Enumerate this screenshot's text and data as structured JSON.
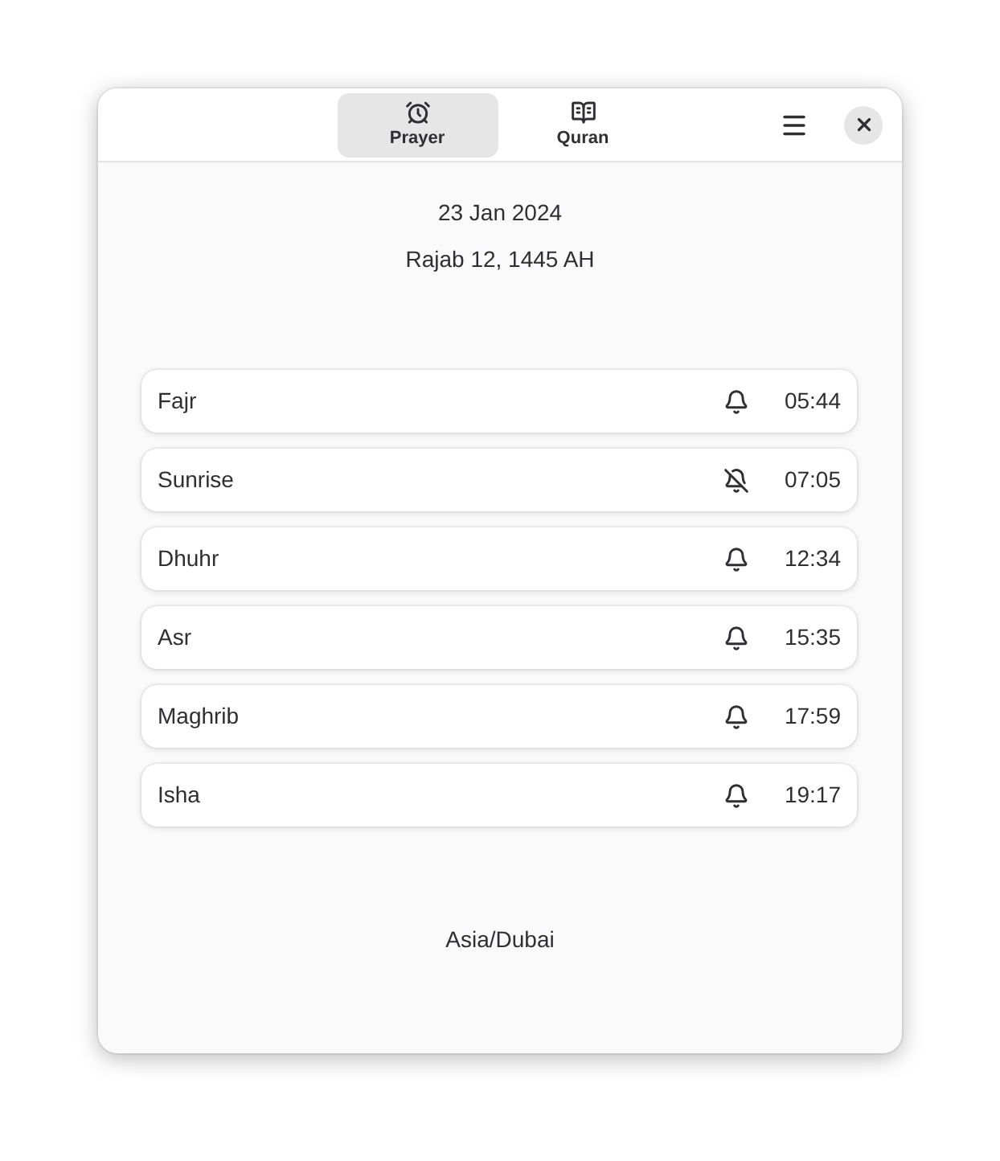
{
  "header": {
    "tabs": [
      {
        "label": "Prayer",
        "selected": true
      },
      {
        "label": "Quran",
        "selected": false
      }
    ]
  },
  "dates": {
    "gregorian": "23 Jan 2024",
    "hijri": "Rajab 12, 1445 AH"
  },
  "prayers": [
    {
      "name": "Fajr",
      "notify": true,
      "time": "05:44"
    },
    {
      "name": "Sunrise",
      "notify": false,
      "time": "07:05"
    },
    {
      "name": "Dhuhr",
      "notify": true,
      "time": "12:34"
    },
    {
      "name": "Asr",
      "notify": true,
      "time": "15:35"
    },
    {
      "name": "Maghrib",
      "notify": true,
      "time": "17:59"
    },
    {
      "name": "Isha",
      "notify": true,
      "time": "19:17"
    }
  ],
  "timezone": "Asia/Dubai"
}
